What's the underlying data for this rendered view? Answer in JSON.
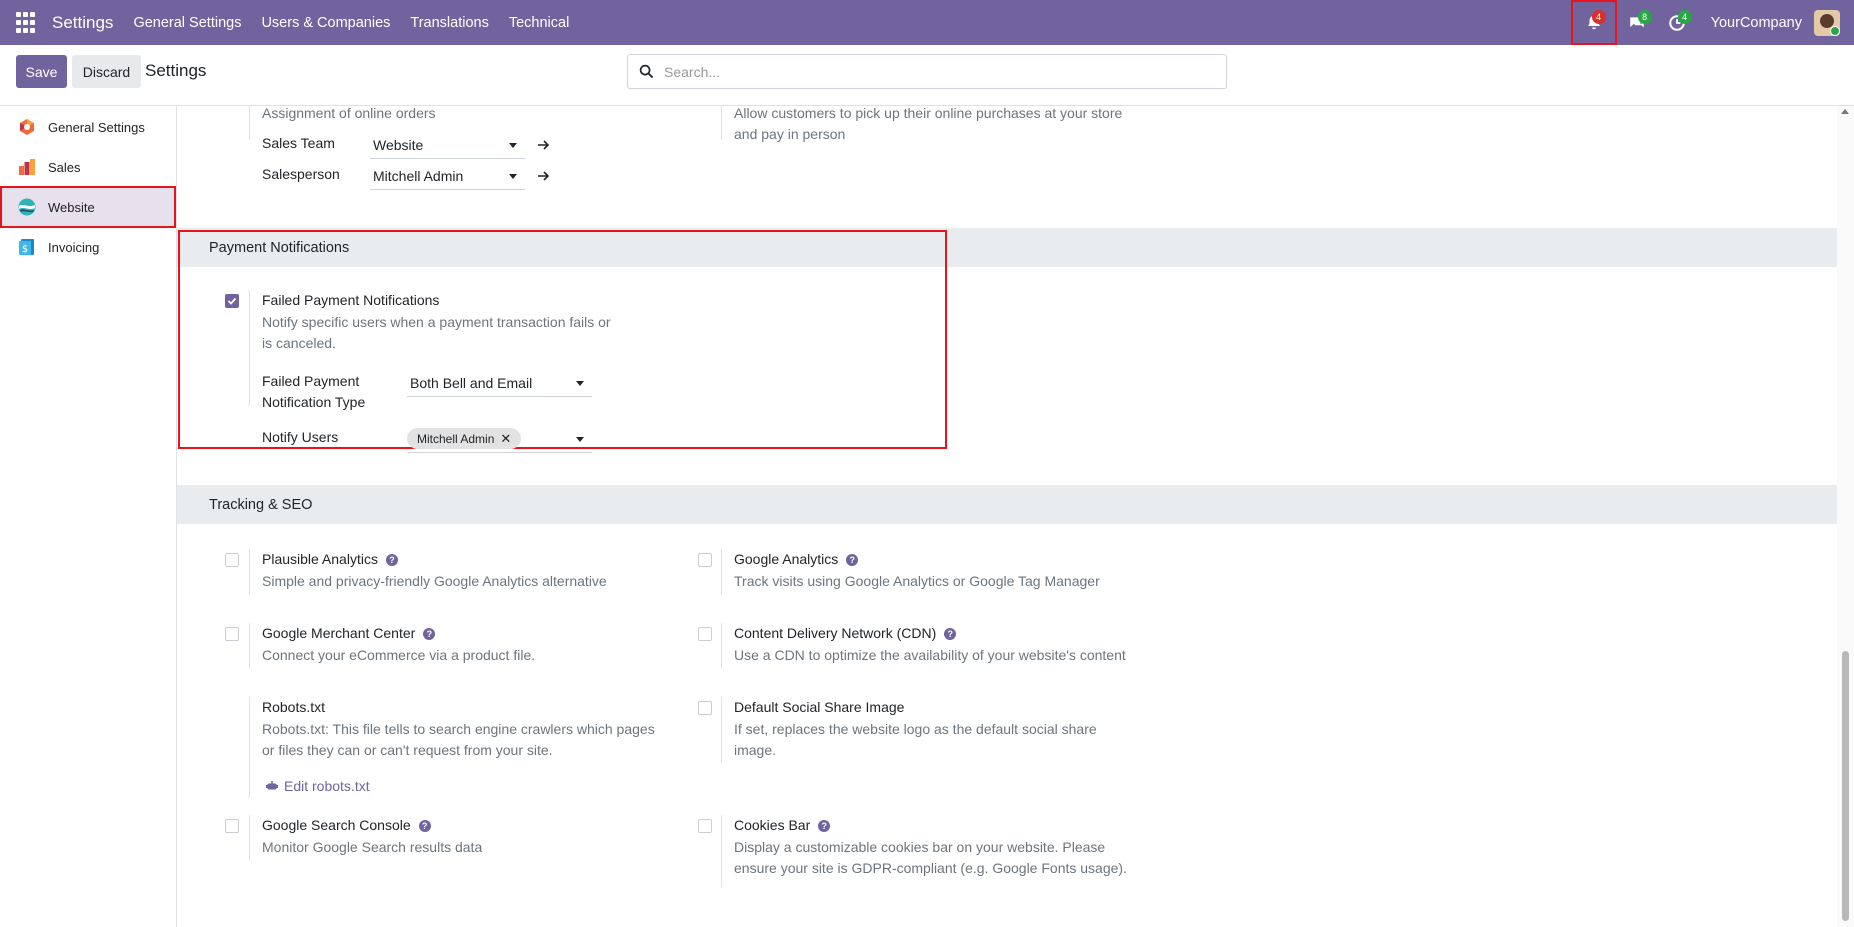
{
  "navbar": {
    "app_title": "Settings",
    "menus": [
      "General Settings",
      "Users & Companies",
      "Translations",
      "Technical"
    ],
    "notifications_count": "4",
    "messages_count": "8",
    "activities_count": "4",
    "company": "YourCompany"
  },
  "control_panel": {
    "save_label": "Save",
    "discard_label": "Discard",
    "title": "Settings",
    "search_placeholder": "Search..."
  },
  "sidebar": {
    "items": [
      {
        "label": "General Settings",
        "icon": "general-settings-icon"
      },
      {
        "label": "Sales",
        "icon": "sales-icon"
      },
      {
        "label": "Website",
        "icon": "website-icon",
        "active": true
      },
      {
        "label": "Invoicing",
        "icon": "invoicing-icon"
      }
    ]
  },
  "orders_section": {
    "left_desc_partial": "Assignment of online orders",
    "right_desc": "Allow customers to pick up their online purchases at your store and pay in person",
    "sales_team_label": "Sales Team",
    "sales_team_value": "Website",
    "salesperson_label": "Salesperson",
    "salesperson_value": "Mitchell Admin"
  },
  "payment_notifications": {
    "heading": "Payment Notifications",
    "setting_title": "Failed Payment Notifications",
    "setting_desc": "Notify specific users when a payment transaction fails or is canceled.",
    "checked": true,
    "type_label": "Failed Payment Notification Type",
    "type_value": "Both Bell and Email",
    "users_label": "Notify Users",
    "users_tag": "Mitchell Admin"
  },
  "tracking_seo": {
    "heading": "Tracking & SEO",
    "settings": [
      {
        "title": "Plausible Analytics",
        "desc": "Simple and privacy-friendly Google Analytics alternative",
        "checked": false
      },
      {
        "title": "Google Analytics",
        "desc": "Track visits using Google Analytics or Google Tag Manager",
        "checked": false
      },
      {
        "title": "Google Merchant Center",
        "desc": "Connect your eCommerce via a product file.",
        "checked": false
      },
      {
        "title": "Content Delivery Network (CDN)",
        "desc": "Use a CDN to optimize the availability of your website's content",
        "checked": false
      },
      {
        "title": "Robots.txt",
        "desc": "Robots.txt: This file tells to search engine crawlers which pages or files they can or can't request from your site.",
        "link": "Edit robots.txt"
      },
      {
        "title": "Default Social Share Image",
        "desc": "If set, replaces the website logo as the default social share image.",
        "checked": false
      },
      {
        "title": "Google Search Console",
        "desc": "Monitor Google Search results data",
        "checked": false
      },
      {
        "title": "Cookies Bar",
        "desc": "Display a customizable cookies bar on your website. Please ensure your site is GDPR-compliant (e.g. Google Fonts usage).",
        "checked": false
      }
    ]
  },
  "colors": {
    "brand": "#71639e",
    "highlight": "#e8131b"
  }
}
